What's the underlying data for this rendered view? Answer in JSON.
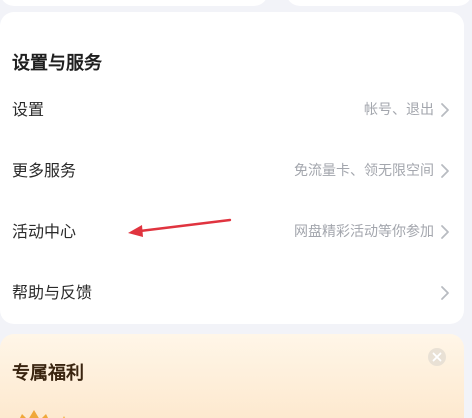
{
  "settings_section": {
    "title": "设置与服务",
    "rows": [
      {
        "label": "设置",
        "detail": "帐号、退出"
      },
      {
        "label": "更多服务",
        "detail": "免流量卡、领无限空间"
      },
      {
        "label": "活动中心",
        "detail": "网盘精彩活动等你参加"
      },
      {
        "label": "帮助与反馈",
        "detail": ""
      }
    ]
  },
  "welfare_section": {
    "title": "专属福利"
  },
  "colors": {
    "background": "#f2f3f8",
    "card": "#ffffff",
    "muted_text": "#a3a6ad",
    "annotation_arrow": "#e0343f"
  },
  "icons": {
    "chevron": "chevron-right-icon",
    "close": "close-icon",
    "annotation": "red-arrow-annotation"
  }
}
